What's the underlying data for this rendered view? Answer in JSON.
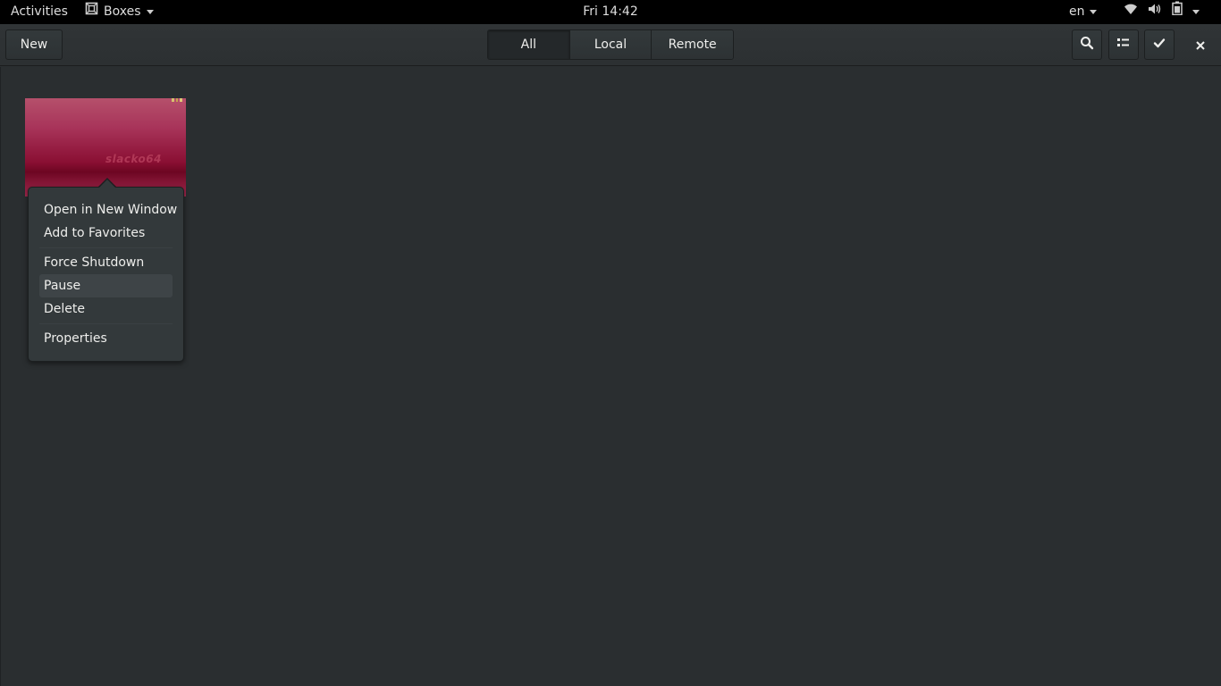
{
  "topbar": {
    "activities": "Activities",
    "app_name": "Boxes",
    "clock": "Fri 14:42",
    "keyboard_layout": "en",
    "icons": [
      "wifi-icon",
      "volume-icon",
      "battery-icon",
      "system-menu-caret-icon"
    ]
  },
  "headerbar": {
    "new_label": "New",
    "view_tabs": [
      {
        "label": "All",
        "active": true
      },
      {
        "label": "Local",
        "active": false
      },
      {
        "label": "Remote",
        "active": false
      }
    ],
    "icons": [
      "search-icon",
      "list-view-icon",
      "selection-mode-icon",
      "close-icon"
    ]
  },
  "box": {
    "screen_text": "slacko64"
  },
  "context_menu": {
    "group1": [
      "Open in New Window",
      "Add to Favorites"
    ],
    "group2": [
      "Force Shutdown",
      "Pause",
      "Delete"
    ],
    "group3": [
      "Properties"
    ],
    "highlighted": "Pause"
  },
  "colors": {
    "window_bg": "#2a2e30",
    "headerbar_bg": "#303436",
    "popover_bg": "#33393b",
    "text": "#eeeeec",
    "thumbnail_accent": "#8a0f33"
  }
}
